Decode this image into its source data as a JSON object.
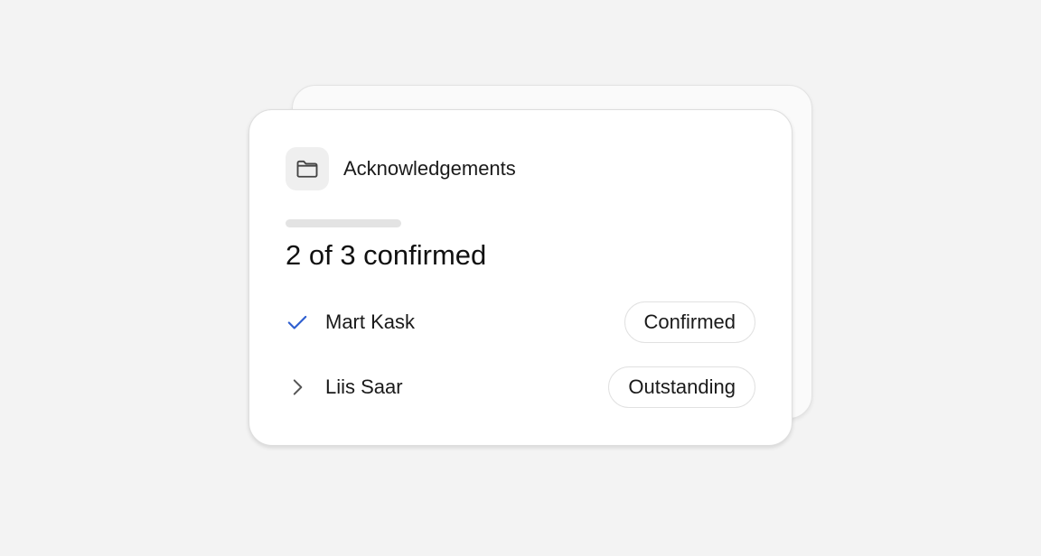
{
  "card": {
    "title": "Acknowledgements",
    "folder_icon": "folder-icon",
    "progress": {
      "confirmed": 2,
      "total": 3
    },
    "summary": "2 of 3 confirmed"
  },
  "rows": [
    {
      "name": "Mart Kask",
      "status": "Confirmed",
      "icon": "check-icon",
      "icon_color": "#2f5fd0"
    },
    {
      "name": "Liis Saar",
      "status": "Outstanding",
      "icon": "chevron-right-icon",
      "icon_color": "#555555"
    }
  ],
  "colors": {
    "background": "#f3f3f3",
    "card": "#ffffff",
    "accent": "#2f5fd0"
  }
}
